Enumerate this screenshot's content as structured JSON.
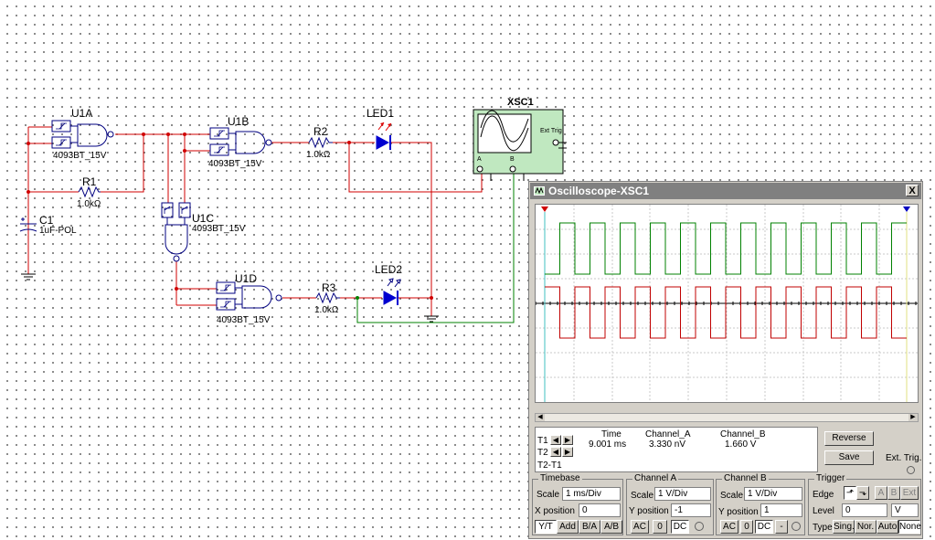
{
  "schematic": {
    "gates": [
      {
        "ref": "U1A",
        "part": "4093BT_15V"
      },
      {
        "ref": "U1B",
        "part": "4093BT_15V"
      },
      {
        "ref": "U1C",
        "part": "4093BT_15V"
      },
      {
        "ref": "U1D",
        "part": "4093BT_15V"
      }
    ],
    "resistors": [
      {
        "ref": "R1",
        "value": "1.0kΩ"
      },
      {
        "ref": "R2",
        "value": "1.0kΩ"
      },
      {
        "ref": "R3",
        "value": "1.0kΩ"
      }
    ],
    "capacitor": {
      "ref": "C1",
      "value": "1uF-POL"
    },
    "leds": [
      {
        "ref": "LED1"
      },
      {
        "ref": "LED2"
      }
    ],
    "scope_symbol": {
      "ref": "XSC1",
      "ext_trig": "Ext Trig",
      "ch_a": "A",
      "ch_b": "B"
    }
  },
  "oscilloscope": {
    "title": "Oscilloscope-XSC1",
    "close": "X",
    "readout": {
      "headers": [
        "Time",
        "Channel_A",
        "Channel_B"
      ],
      "rows": [
        {
          "label": "T1",
          "time": "9.001 ms",
          "a": "3.330 nV",
          "b": "1.660 V"
        },
        {
          "label": "T2"
        },
        {
          "label": "T2-T1"
        }
      ]
    },
    "buttons": {
      "reverse": "Reverse",
      "save": "Save",
      "ext_trig": "Ext. Trig."
    },
    "timebase": {
      "title": "Timebase",
      "scale_label": "Scale",
      "scale": "1 ms/Div",
      "xpos_label": "X position",
      "xpos": "0",
      "modes": [
        "Y/T",
        "Add",
        "B/A",
        "A/B"
      ]
    },
    "channel_a": {
      "title": "Channel A",
      "scale_label": "Scale",
      "scale": "1  V/Div",
      "ypos_label": "Y position",
      "ypos": "-1",
      "coupling": [
        "AC",
        "0",
        "DC"
      ]
    },
    "channel_b": {
      "title": "Channel B",
      "scale_label": "Scale",
      "scale": "1  V/Div",
      "ypos_label": "Y position",
      "ypos": "1",
      "coupling": [
        "AC",
        "0",
        "DC",
        "-"
      ]
    },
    "trigger": {
      "title": "Trigger",
      "edge_label": "Edge",
      "sources": [
        "A",
        "B",
        "Ext"
      ],
      "level_label": "Level",
      "level": "0",
      "level_unit": "V",
      "type_label": "Type",
      "types": [
        "Sing.",
        "Nor.",
        "Auto",
        "None"
      ]
    },
    "traces": {
      "channel_a": {
        "color": "#008000",
        "cycles_on_screen": 12
      },
      "channel_b": {
        "color": "#c00000",
        "cycles_on_screen": 12
      }
    }
  }
}
